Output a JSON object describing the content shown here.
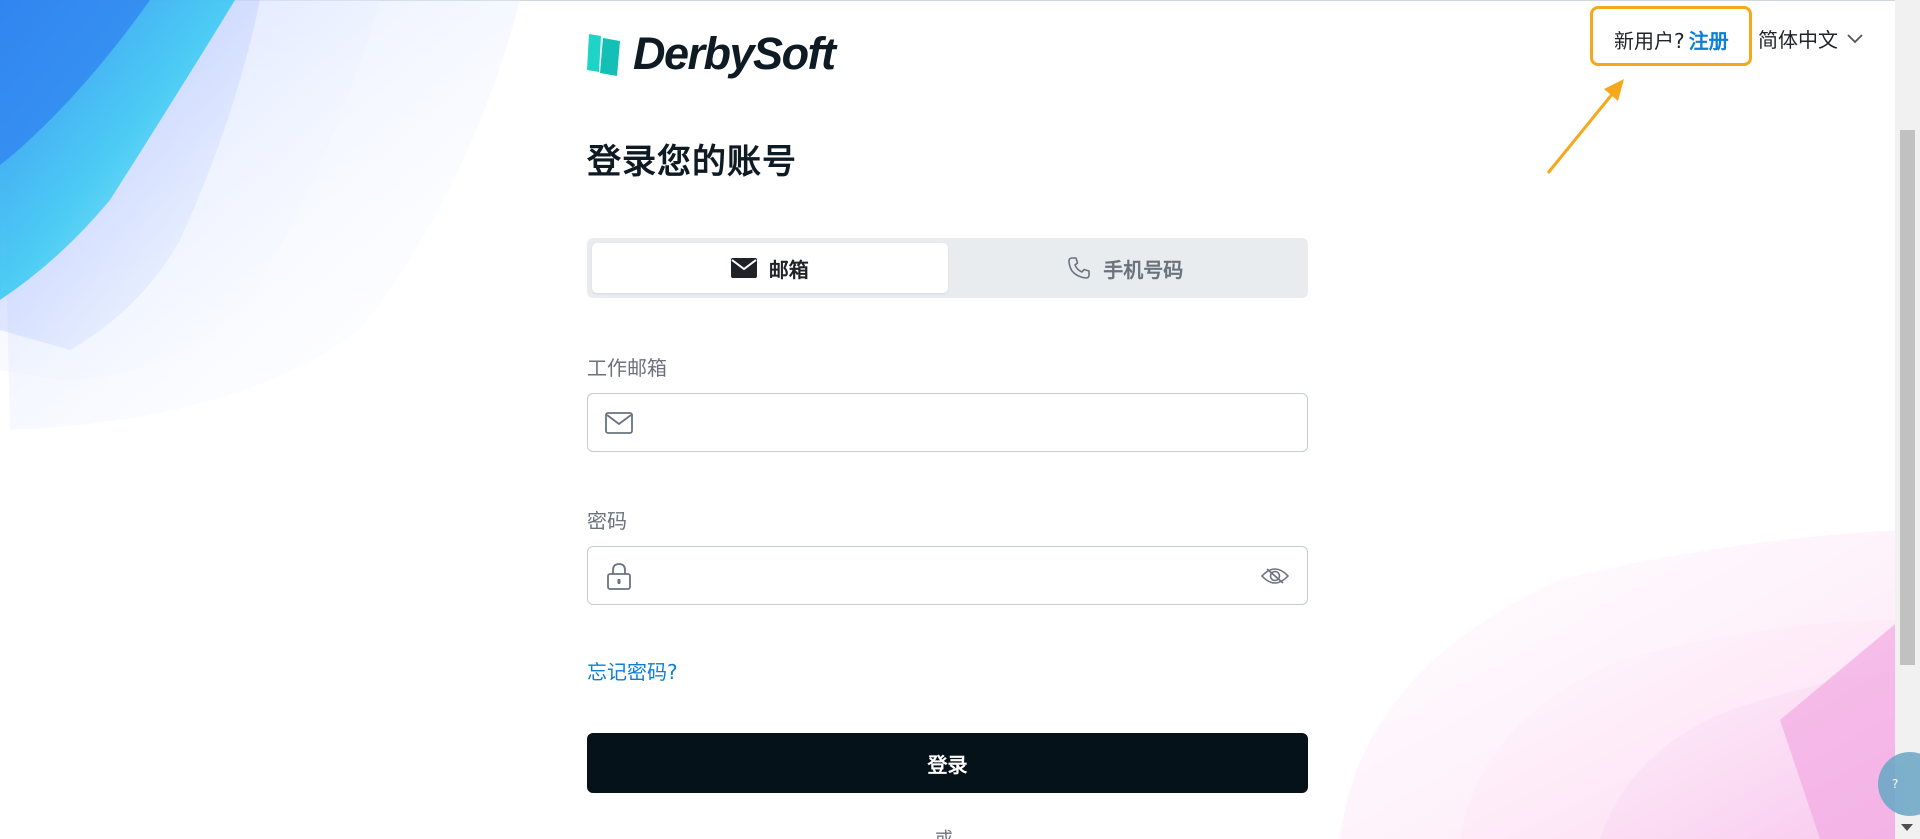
{
  "header": {
    "logo_text": "DerbySoft",
    "register_prompt": "新用户?",
    "register_link": "注册",
    "language": "简体中文"
  },
  "page_title": "登录您的账号",
  "tabs": [
    {
      "label": "邮箱",
      "icon": "envelope-icon",
      "active": true
    },
    {
      "label": "手机号码",
      "icon": "phone-icon",
      "active": false
    }
  ],
  "email_field": {
    "label": "工作邮箱",
    "value": "",
    "placeholder": ""
  },
  "password_field": {
    "label": "密码",
    "value": "",
    "placeholder": ""
  },
  "forgot_password": "忘记密码?",
  "login_button": "登录",
  "divider_text": "或",
  "colors": {
    "accent_link": "#0a7fd6",
    "primary_button": "#06121a",
    "annotation": "#f5a81c",
    "logo_mark": "#1fd3c7"
  }
}
